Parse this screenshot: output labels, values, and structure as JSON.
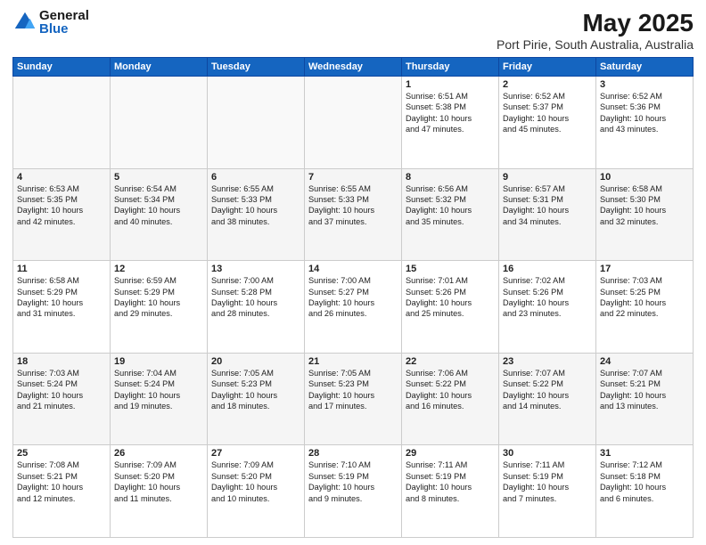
{
  "logo": {
    "general": "General",
    "blue": "Blue"
  },
  "title": "May 2025",
  "location": "Port Pirie, South Australia, Australia",
  "days_of_week": [
    "Sunday",
    "Monday",
    "Tuesday",
    "Wednesday",
    "Thursday",
    "Friday",
    "Saturday"
  ],
  "weeks": [
    [
      {
        "day": "",
        "info": ""
      },
      {
        "day": "",
        "info": ""
      },
      {
        "day": "",
        "info": ""
      },
      {
        "day": "",
        "info": ""
      },
      {
        "day": "1",
        "info": "Sunrise: 6:51 AM\nSunset: 5:38 PM\nDaylight: 10 hours\nand 47 minutes."
      },
      {
        "day": "2",
        "info": "Sunrise: 6:52 AM\nSunset: 5:37 PM\nDaylight: 10 hours\nand 45 minutes."
      },
      {
        "day": "3",
        "info": "Sunrise: 6:52 AM\nSunset: 5:36 PM\nDaylight: 10 hours\nand 43 minutes."
      }
    ],
    [
      {
        "day": "4",
        "info": "Sunrise: 6:53 AM\nSunset: 5:35 PM\nDaylight: 10 hours\nand 42 minutes."
      },
      {
        "day": "5",
        "info": "Sunrise: 6:54 AM\nSunset: 5:34 PM\nDaylight: 10 hours\nand 40 minutes."
      },
      {
        "day": "6",
        "info": "Sunrise: 6:55 AM\nSunset: 5:33 PM\nDaylight: 10 hours\nand 38 minutes."
      },
      {
        "day": "7",
        "info": "Sunrise: 6:55 AM\nSunset: 5:33 PM\nDaylight: 10 hours\nand 37 minutes."
      },
      {
        "day": "8",
        "info": "Sunrise: 6:56 AM\nSunset: 5:32 PM\nDaylight: 10 hours\nand 35 minutes."
      },
      {
        "day": "9",
        "info": "Sunrise: 6:57 AM\nSunset: 5:31 PM\nDaylight: 10 hours\nand 34 minutes."
      },
      {
        "day": "10",
        "info": "Sunrise: 6:58 AM\nSunset: 5:30 PM\nDaylight: 10 hours\nand 32 minutes."
      }
    ],
    [
      {
        "day": "11",
        "info": "Sunrise: 6:58 AM\nSunset: 5:29 PM\nDaylight: 10 hours\nand 31 minutes."
      },
      {
        "day": "12",
        "info": "Sunrise: 6:59 AM\nSunset: 5:29 PM\nDaylight: 10 hours\nand 29 minutes."
      },
      {
        "day": "13",
        "info": "Sunrise: 7:00 AM\nSunset: 5:28 PM\nDaylight: 10 hours\nand 28 minutes."
      },
      {
        "day": "14",
        "info": "Sunrise: 7:00 AM\nSunset: 5:27 PM\nDaylight: 10 hours\nand 26 minutes."
      },
      {
        "day": "15",
        "info": "Sunrise: 7:01 AM\nSunset: 5:26 PM\nDaylight: 10 hours\nand 25 minutes."
      },
      {
        "day": "16",
        "info": "Sunrise: 7:02 AM\nSunset: 5:26 PM\nDaylight: 10 hours\nand 23 minutes."
      },
      {
        "day": "17",
        "info": "Sunrise: 7:03 AM\nSunset: 5:25 PM\nDaylight: 10 hours\nand 22 minutes."
      }
    ],
    [
      {
        "day": "18",
        "info": "Sunrise: 7:03 AM\nSunset: 5:24 PM\nDaylight: 10 hours\nand 21 minutes."
      },
      {
        "day": "19",
        "info": "Sunrise: 7:04 AM\nSunset: 5:24 PM\nDaylight: 10 hours\nand 19 minutes."
      },
      {
        "day": "20",
        "info": "Sunrise: 7:05 AM\nSunset: 5:23 PM\nDaylight: 10 hours\nand 18 minutes."
      },
      {
        "day": "21",
        "info": "Sunrise: 7:05 AM\nSunset: 5:23 PM\nDaylight: 10 hours\nand 17 minutes."
      },
      {
        "day": "22",
        "info": "Sunrise: 7:06 AM\nSunset: 5:22 PM\nDaylight: 10 hours\nand 16 minutes."
      },
      {
        "day": "23",
        "info": "Sunrise: 7:07 AM\nSunset: 5:22 PM\nDaylight: 10 hours\nand 14 minutes."
      },
      {
        "day": "24",
        "info": "Sunrise: 7:07 AM\nSunset: 5:21 PM\nDaylight: 10 hours\nand 13 minutes."
      }
    ],
    [
      {
        "day": "25",
        "info": "Sunrise: 7:08 AM\nSunset: 5:21 PM\nDaylight: 10 hours\nand 12 minutes."
      },
      {
        "day": "26",
        "info": "Sunrise: 7:09 AM\nSunset: 5:20 PM\nDaylight: 10 hours\nand 11 minutes."
      },
      {
        "day": "27",
        "info": "Sunrise: 7:09 AM\nSunset: 5:20 PM\nDaylight: 10 hours\nand 10 minutes."
      },
      {
        "day": "28",
        "info": "Sunrise: 7:10 AM\nSunset: 5:19 PM\nDaylight: 10 hours\nand 9 minutes."
      },
      {
        "day": "29",
        "info": "Sunrise: 7:11 AM\nSunset: 5:19 PM\nDaylight: 10 hours\nand 8 minutes."
      },
      {
        "day": "30",
        "info": "Sunrise: 7:11 AM\nSunset: 5:19 PM\nDaylight: 10 hours\nand 7 minutes."
      },
      {
        "day": "31",
        "info": "Sunrise: 7:12 AM\nSunset: 5:18 PM\nDaylight: 10 hours\nand 6 minutes."
      }
    ]
  ]
}
